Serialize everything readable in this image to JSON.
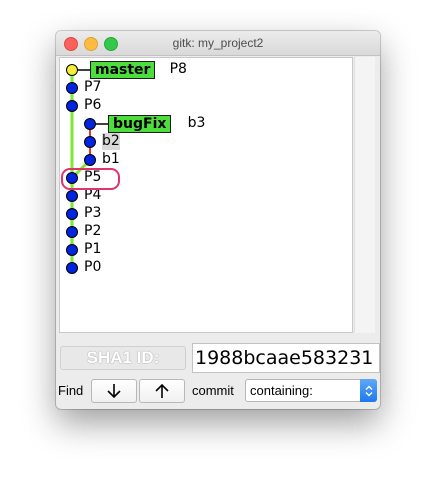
{
  "window": {
    "title": "gitk: my_project2"
  },
  "colors": {
    "branch_tag": "#4ddd3d",
    "graph_line_main": "#7ee833",
    "graph_line_branch": "#e03a2e",
    "commit_dot": "#0024e0",
    "head_dot": "#f5ee34",
    "highlight_ring": "#e2336b",
    "select_accent": "#1f79ee"
  },
  "graph": {
    "branches": [
      {
        "label": "master"
      },
      {
        "label": "bugFix"
      }
    ],
    "commits": [
      {
        "label": "P8",
        "branch_tag": "master",
        "is_head": true
      },
      {
        "label": "P7"
      },
      {
        "label": "P6"
      },
      {
        "label": "b3",
        "branch_tag": "bugFix"
      },
      {
        "label": "b2",
        "selected": true
      },
      {
        "label": "b1"
      },
      {
        "label": "P5",
        "highlighted": true
      },
      {
        "label": "P4"
      },
      {
        "label": "P3"
      },
      {
        "label": "P2"
      },
      {
        "label": "P1"
      },
      {
        "label": "P0"
      }
    ]
  },
  "sha": {
    "label": "SHA1 ID:",
    "value": "1988bcaae583231"
  },
  "find": {
    "label": "Find",
    "down_icon": "arrow-down-icon",
    "up_icon": "arrow-up-icon",
    "commit_label": "commit",
    "mode": "containing:",
    "dropdown_icon": "chevron-updown-icon"
  }
}
